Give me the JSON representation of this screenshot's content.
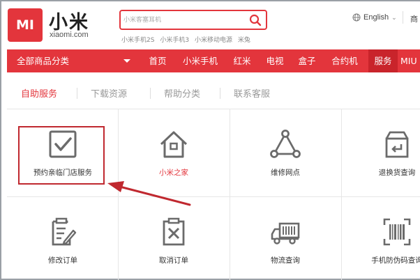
{
  "header": {
    "logo_text": "MI",
    "brand_cn": "小米",
    "brand_en": "xiaomi.com",
    "search_placeholder": "小米客塞耳机",
    "hot_searches": [
      "小米手机2S",
      "小米手机3",
      "小米移动电源",
      "米兔"
    ],
    "language": "English",
    "cut_right_text": "商"
  },
  "nav": {
    "all_categories": "全部商品分类",
    "items": [
      {
        "label": "首页",
        "active": false
      },
      {
        "label": "小米手机",
        "active": false
      },
      {
        "label": "红米",
        "active": false
      },
      {
        "label": "电视",
        "active": false
      },
      {
        "label": "盒子",
        "active": false
      },
      {
        "label": "合约机",
        "active": false
      },
      {
        "label": "服务",
        "active": true
      },
      {
        "label": "MIU",
        "active": false
      }
    ]
  },
  "tabs": [
    {
      "label": "自助服务",
      "active": true
    },
    {
      "label": "下载资源",
      "active": false
    },
    {
      "label": "帮助分类",
      "active": false
    },
    {
      "label": "联系客服",
      "active": false
    }
  ],
  "services": [
    {
      "label": "预约亲临门店服务",
      "icon": "checkbox-icon",
      "highlight": true
    },
    {
      "label": "小米之家",
      "icon": "home-icon",
      "red": true
    },
    {
      "label": "维修网点",
      "icon": "network-triangle-icon"
    },
    {
      "label": "退换货查询",
      "icon": "return-box-icon"
    },
    {
      "label": "修改订单",
      "icon": "edit-document-icon"
    },
    {
      "label": "取消订单",
      "icon": "cancel-document-icon"
    },
    {
      "label": "物流查询",
      "icon": "truck-icon"
    },
    {
      "label": "手机防伪码查询",
      "icon": "barcode-icon"
    }
  ],
  "colors": {
    "brand_red": "#e3353c",
    "active_nav": "#c9242b",
    "icon_gray": "#6b6b6b",
    "annotation_red": "#c0282f"
  }
}
